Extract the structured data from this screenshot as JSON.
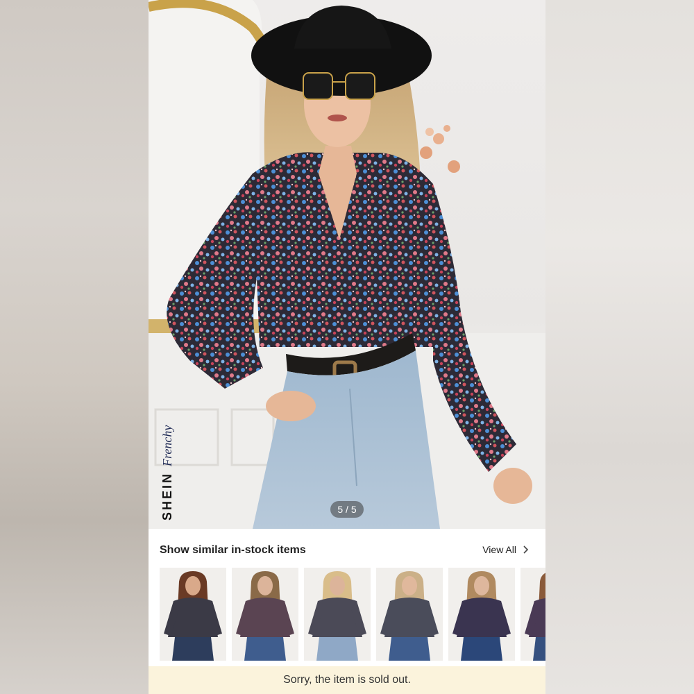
{
  "brand": {
    "name": "SHEIN",
    "line": "Frenchy"
  },
  "gallery": {
    "counter": "5 / 5"
  },
  "similar": {
    "title": "Show similar in-stock items",
    "view_all": "View All",
    "chevron_icon": "chevron-right-icon",
    "items": [
      {
        "name": "similar-item-1",
        "shirt": "#3b3a46",
        "bottom": "#2d3d5c",
        "skin": "#d9a98a",
        "hair": "#6a3a25"
      },
      {
        "name": "similar-item-2",
        "shirt": "#5a4452",
        "bottom": "#3f5d8e",
        "skin": "#dcb49a",
        "hair": "#8a6a48"
      },
      {
        "name": "similar-item-3",
        "shirt": "#4b4a57",
        "bottom": "#8fa8c6",
        "skin": "#dcb49a",
        "hair": "#d9bd8a"
      },
      {
        "name": "similar-item-4",
        "shirt": "#4a4c5a",
        "bottom": "#3f5d8e",
        "skin": "#e0b89c",
        "hair": "#cbb088"
      },
      {
        "name": "similar-item-5",
        "shirt": "#3a3450",
        "bottom": "#2b4779",
        "skin": "#deb79d",
        "hair": "#b08a60"
      },
      {
        "name": "similar-item-6",
        "shirt": "#4a3a55",
        "bottom": "#35507f",
        "skin": "#deb79d",
        "hair": "#8a5a3a"
      }
    ]
  },
  "status": {
    "message": "Sorry, the item is sold out."
  },
  "colors": {
    "sold_out_bg": "#fbf3dc",
    "counter_bg": "#3c3c3c"
  }
}
